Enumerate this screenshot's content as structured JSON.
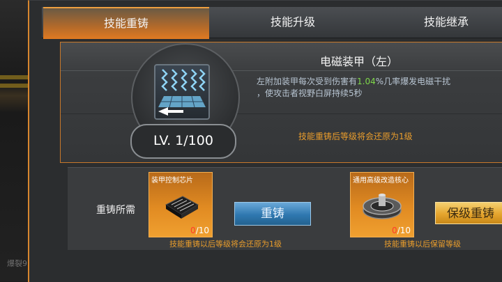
{
  "tabs": [
    {
      "label": "技能重铸",
      "active": true
    },
    {
      "label": "技能升级",
      "active": false
    },
    {
      "label": "技能继承",
      "active": false
    }
  ],
  "background": {
    "caption": "爆裂9"
  },
  "skill": {
    "name": "电磁装甲（左）",
    "desc_prefix": "左附加装甲每次受到伤害有",
    "desc_value": "1.04",
    "desc_suffix": "%几率爆发电磁干扰",
    "desc_line2": "，使攻击者视野白屏持续5秒",
    "level": "LV. 1/100",
    "reset_note": "技能重铸后等级将会还原为1级",
    "icon": "electromagnetic-armor-icon"
  },
  "requirements": {
    "label": "重铸所需",
    "items": [
      {
        "name": "装甲控制芯片",
        "have": "0",
        "need": "/10",
        "icon": "chip-icon",
        "note": "技能重铸以后等级将会还原为1级"
      },
      {
        "name": "通用高级改造核心",
        "have": "0",
        "need": "/10",
        "icon": "core-icon",
        "note": "技能重铸以后保留等级"
      }
    ],
    "reforge_button": "重铸",
    "keep_level_button": "保级重铸"
  },
  "colors": {
    "accent": "#e07a22",
    "highlight": "#7fd84a",
    "warning": "#e89c2c",
    "count_red": "#ff3a2a"
  }
}
